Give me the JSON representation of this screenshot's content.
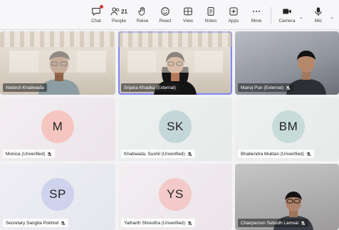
{
  "toolbar": {
    "items": [
      {
        "key": "chat",
        "label": "Chat",
        "icon": "chat-icon"
      },
      {
        "key": "people",
        "label": "People",
        "icon": "people-icon",
        "count": "21"
      },
      {
        "key": "raise",
        "label": "Raise",
        "icon": "raise-hand-icon"
      },
      {
        "key": "react",
        "label": "React",
        "icon": "react-icon"
      },
      {
        "key": "view",
        "label": "View",
        "icon": "view-icon"
      },
      {
        "key": "notes",
        "label": "Notes",
        "icon": "notes-icon"
      },
      {
        "key": "apps",
        "label": "Apps",
        "icon": "apps-icon"
      },
      {
        "key": "more",
        "label": "More",
        "icon": "more-icon"
      },
      {
        "key": "camera",
        "label": "Camera",
        "icon": "camera-icon"
      },
      {
        "key": "mic",
        "label": "Mic",
        "icon": "mic-icon"
      }
    ]
  },
  "tiles": [
    {
      "name": "Nedesh Khatiwada",
      "kind": "video",
      "muted": false
    },
    {
      "name": "Srijana Khadka (External)",
      "kind": "video",
      "muted": false,
      "active": true
    },
    {
      "name": "Manoj Pun (External)",
      "kind": "video",
      "muted": true
    },
    {
      "name": "Monica (Unverified)",
      "initials": "M",
      "kind": "avatar",
      "muted": true,
      "avatar_color": "#f5c6c0"
    },
    {
      "name": "Khatiwada, Sushil (Unverified)",
      "initials": "SK",
      "kind": "avatar",
      "muted": true,
      "avatar_color": "#c3d6d8"
    },
    {
      "name": "Bhabendra Muktan (Unverified)",
      "initials": "BM",
      "kind": "avatar",
      "muted": true,
      "avatar_color": "#c7dcd9"
    },
    {
      "name": "Secretary Sangita Pokhrel",
      "initials": "SP",
      "kind": "avatar",
      "muted": true,
      "avatar_color": "#cfd2ec"
    },
    {
      "name": "Yatharth Shrestha (Unverified)",
      "initials": "YS",
      "kind": "avatar",
      "muted": true,
      "avatar_color": "#f3c9c9"
    },
    {
      "name": "Chairperson Subodh Lamsal",
      "kind": "video",
      "muted": true
    }
  ],
  "colors": {
    "accent": "#7f85f5",
    "notification": "#d13438"
  }
}
